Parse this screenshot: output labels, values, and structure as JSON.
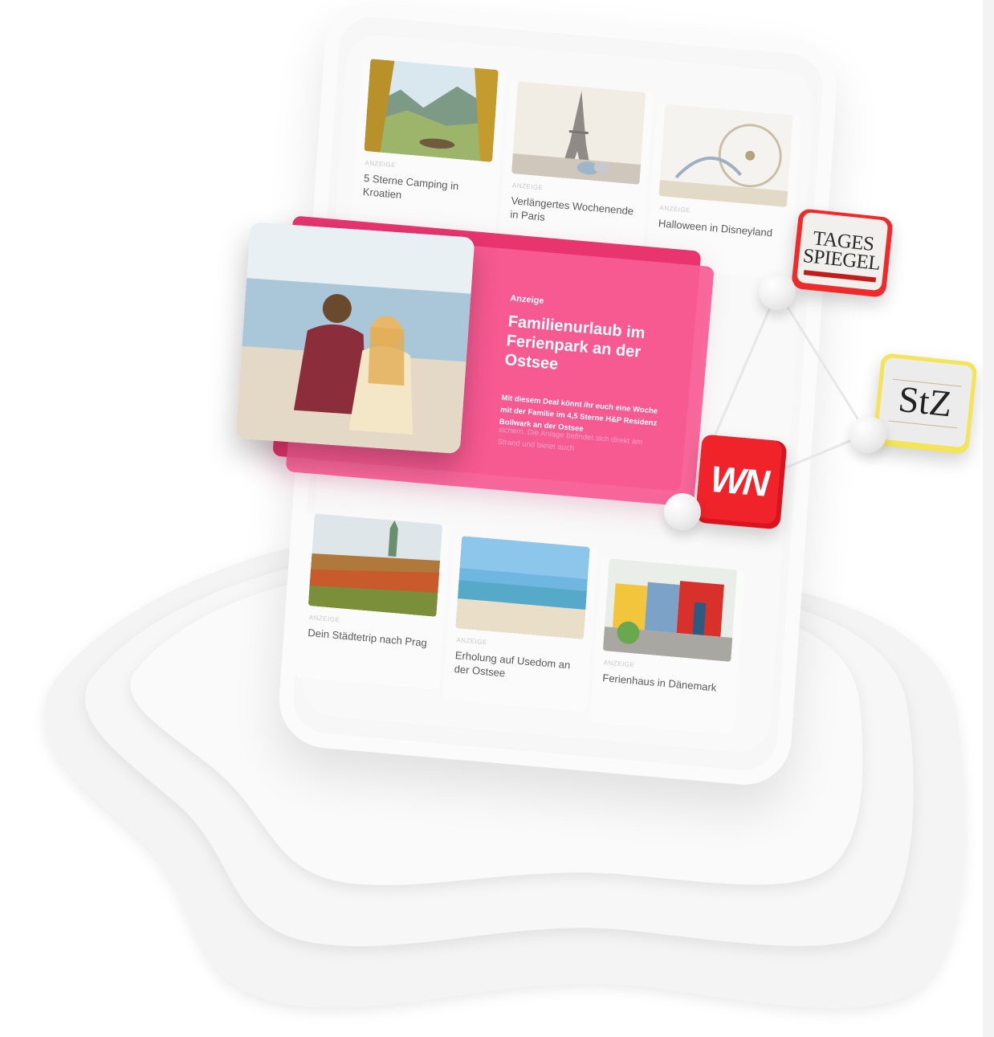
{
  "cards": [
    {
      "meta": "ANZEIGE",
      "title": "5 Sterne Camping in Kroatien"
    },
    {
      "meta": "ANZEIGE",
      "title": "Verlängertes Wochenende in Paris"
    },
    {
      "meta": "ANZEIGE",
      "title": "Halloween in Disneyland"
    },
    {
      "meta": "ANZEIGE",
      "title": "Dein Städtetrip nach Prag"
    },
    {
      "meta": "ANZEIGE",
      "title": "Erholung auf Usedom an der Ostsee"
    },
    {
      "meta": "ANZEIGE",
      "title": "Ferienhaus in Dänemark"
    }
  ],
  "ad": {
    "label": "Anzeige",
    "title": "Familienurlaub im Ferienpark an der Ostsee",
    "body": "Mit diesem Deal könnt ihr euch eine Woche mit der Familie im 4,5 Sterne H&P Residenz Bollwark an der Ostsee",
    "body_faded": "sichern. Die Anlage befindet sich direkt am Strand und bietet auch"
  },
  "logos": {
    "tagesspiegel_line1": "TAGES",
    "tagesspiegel_line2": "SPIEGEL",
    "stz": "StZ",
    "wn": "WN"
  },
  "colors": {
    "accent_pink": "#f75c94",
    "ad_back": "#e8356f",
    "wn_red": "#f0222a",
    "stz_yellow": "#f4e45a",
    "ts_red": "#ef2a2a"
  }
}
